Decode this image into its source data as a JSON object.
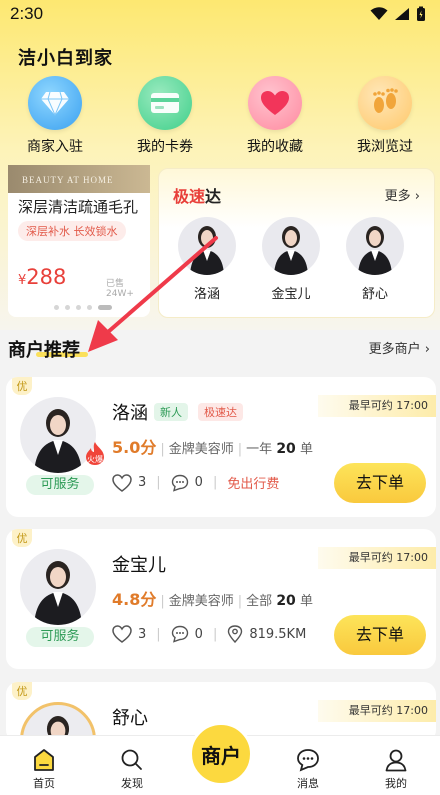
{
  "status_bar": {
    "time": "2:30"
  },
  "app_title": "洁小白到家",
  "quick_nav": [
    {
      "label": "商家入驻",
      "icon": "diamond-icon"
    },
    {
      "label": "我的卡券",
      "icon": "card-icon"
    },
    {
      "label": "我的收藏",
      "icon": "heart-icon"
    },
    {
      "label": "我浏览过",
      "icon": "footprint-icon"
    }
  ],
  "banner": {
    "image_text": "BEAUTY AT HOME",
    "title": "深层清洁疏通毛孔",
    "tag": "深层补水 长效锁水",
    "currency": "¥",
    "price": "288",
    "sold": "已售24W+"
  },
  "express": {
    "title_red": "极速",
    "title_dark": "达",
    "more": "更多",
    "people": [
      {
        "name": "洛涵"
      },
      {
        "name": "金宝儿"
      },
      {
        "name": "舒心"
      }
    ]
  },
  "section": {
    "title": "商户推荐",
    "more": "更多商户"
  },
  "merchants": [
    {
      "badge": "优",
      "name": "洛涵",
      "tags": [
        "新人",
        "极速达"
      ],
      "earliest": "最早可约 17:00",
      "score": "5.0分",
      "level": "金牌美容师",
      "period_prefix": "一年",
      "orders": "20",
      "orders_unit": "单",
      "likes": "3",
      "comments": "0",
      "extra": "免出行费",
      "hot": "火爆",
      "service": "可服务",
      "button": "去下单"
    },
    {
      "badge": "优",
      "name": "金宝儿",
      "earliest": "最早可约 17:00",
      "score": "4.8分",
      "level": "金牌美容师",
      "period_prefix": "全部",
      "orders": "20",
      "orders_unit": "单",
      "likes": "3",
      "comments": "0",
      "extra": "819.5KM",
      "service": "可服务",
      "button": "去下单"
    },
    {
      "badge": "优",
      "name": "舒心",
      "earliest": "最早可约 17:00"
    }
  ],
  "tab_bar": {
    "items": [
      {
        "label": "首页",
        "icon": "home-icon"
      },
      {
        "label": "发现",
        "icon": "discover-icon"
      },
      {
        "label": "消息",
        "icon": "message-icon"
      },
      {
        "label": "我的",
        "icon": "profile-icon"
      }
    ],
    "center": "商户"
  },
  "colors": {
    "accent_yellow": "#fcd93f",
    "price_red": "#e8403a",
    "score_orange": "#e07b2a",
    "service_green": "#2e9b57"
  }
}
